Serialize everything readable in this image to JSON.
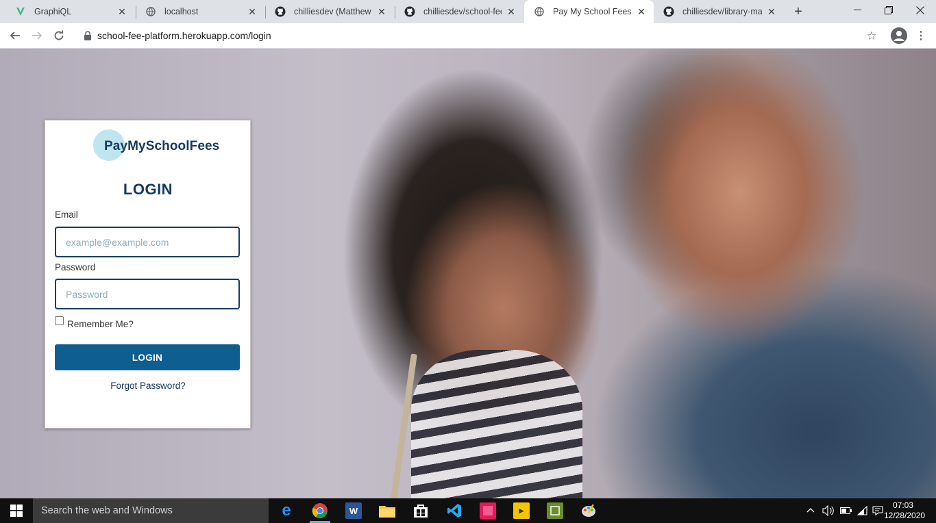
{
  "browser": {
    "tabs": [
      {
        "title": "GraphiQL",
        "icon": "graphiql-icon"
      },
      {
        "title": "localhost",
        "icon": "globe-icon"
      },
      {
        "title": "chilliesdev (Matthew ka",
        "icon": "github-icon"
      },
      {
        "title": "chilliesdev/school-fee-p",
        "icon": "github-icon"
      },
      {
        "title": "Pay My School Fees|Ho",
        "icon": "globe-icon",
        "active": true
      },
      {
        "title": "chilliesdev/library-mana",
        "icon": "github-icon"
      }
    ],
    "url": "school-fee-platform.herokuapp.com/login"
  },
  "login": {
    "logo_text": "PayMySchoolFees",
    "title": "LOGIN",
    "email_label": "Email",
    "email_placeholder": "example@example.com",
    "password_label": "Password",
    "password_placeholder": "Password",
    "remember_label": "Remember Me?",
    "button_label": "LOGIN",
    "forgot_label": "Forgot Password?"
  },
  "taskbar": {
    "search_placeholder": "Search the web and Windows",
    "time": "07:03",
    "date": "12/28/2020"
  },
  "colors": {
    "brand": "#163a63",
    "button": "#0e5e8f",
    "field_border": "#173d5d"
  }
}
